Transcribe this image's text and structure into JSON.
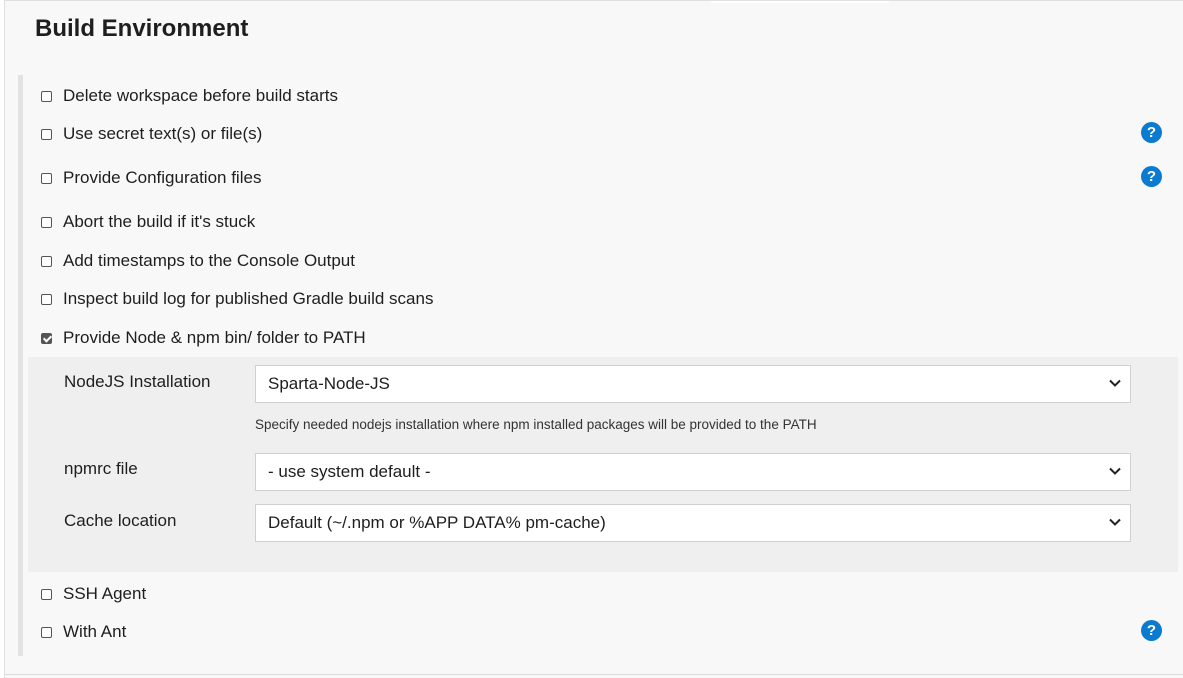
{
  "section": {
    "title": "Build Environment"
  },
  "options": [
    {
      "label": "Delete workspace before build starts",
      "checked": false,
      "help": false
    },
    {
      "label": "Use secret text(s) or file(s)",
      "checked": false,
      "help": true
    },
    {
      "label": "Provide Configuration files",
      "checked": false,
      "help": true
    },
    {
      "label": "Abort the build if it's stuck",
      "checked": false,
      "help": false
    },
    {
      "label": "Add timestamps to the Console Output",
      "checked": false,
      "help": false
    },
    {
      "label": "Inspect build log for published Gradle build scans",
      "checked": false,
      "help": false
    },
    {
      "label": "Provide Node & npm bin/ folder to PATH",
      "checked": true,
      "help": false
    },
    {
      "label": "SSH Agent",
      "checked": false,
      "help": false
    },
    {
      "label": "With Ant",
      "checked": false,
      "help": true
    }
  ],
  "node_config": {
    "nodejs_installation": {
      "label": "NodeJS Installation",
      "value": "Sparta-Node-JS",
      "hint": "Specify needed nodejs installation where npm installed packages will be provided to the PATH"
    },
    "npmrc_file": {
      "label": "npmrc file",
      "value": "- use system default -"
    },
    "cache_location": {
      "label": "Cache location",
      "value": "Default (~/.npm or %APP  DATA% pm-cache)"
    }
  },
  "help_icon_glyph": "?",
  "colors": {
    "help_icon": "#0b7ad1",
    "panel_background": "#f8f8f8",
    "sub_panel_background": "#efefef"
  }
}
